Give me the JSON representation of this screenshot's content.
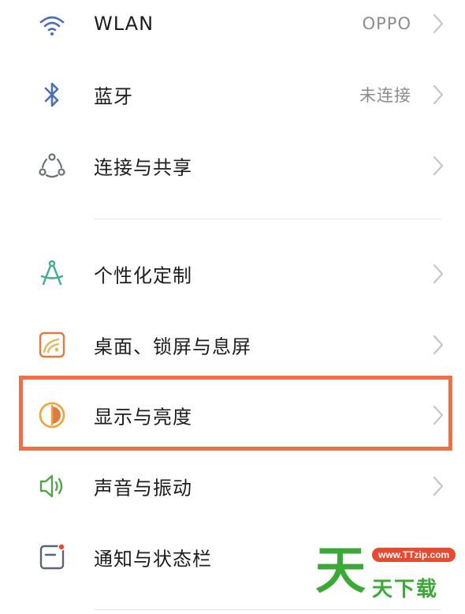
{
  "settings": {
    "items": [
      {
        "label": "WLAN",
        "value": "OPPO"
      },
      {
        "label": "蓝牙",
        "value": "未连接"
      },
      {
        "label": "连接与共享",
        "value": ""
      },
      {
        "label": "个性化定制",
        "value": ""
      },
      {
        "label": "桌面、锁屏与息屏",
        "value": ""
      },
      {
        "label": "显示与亮度",
        "value": ""
      },
      {
        "label": "声音与振动",
        "value": ""
      },
      {
        "label": "通知与状态栏",
        "value": ""
      }
    ]
  },
  "highlight": {
    "color": "#ec7148",
    "target": "显示与亮度"
  },
  "watermark": {
    "url": "www.TTzip.com",
    "char": "天",
    "text": "天下载"
  },
  "colors": {
    "wlan_icon": "#4a6fb3",
    "bluetooth_icon": "#4a6fb3",
    "share_icon": "#6b7079",
    "personalize_icon": "#3fae8f",
    "desktop_icon": "#e07b3e",
    "display_icon": "#f0a33a",
    "sound_icon": "#4fa64a",
    "notification_icon": "#5a6472",
    "chevron": "#c6c6c6"
  }
}
